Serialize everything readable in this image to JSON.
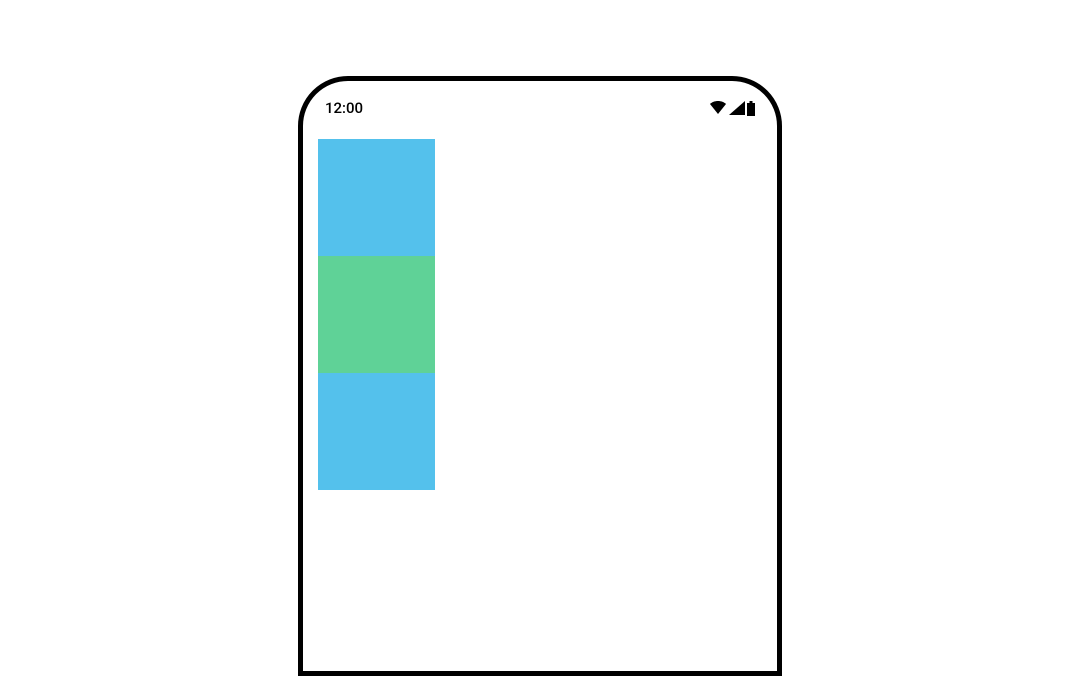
{
  "statusBar": {
    "time": "12:00"
  },
  "colors": {
    "blockTop": "#54c1ec",
    "blockMiddle": "#5fd297",
    "blockBottom": "#54c1ec"
  }
}
